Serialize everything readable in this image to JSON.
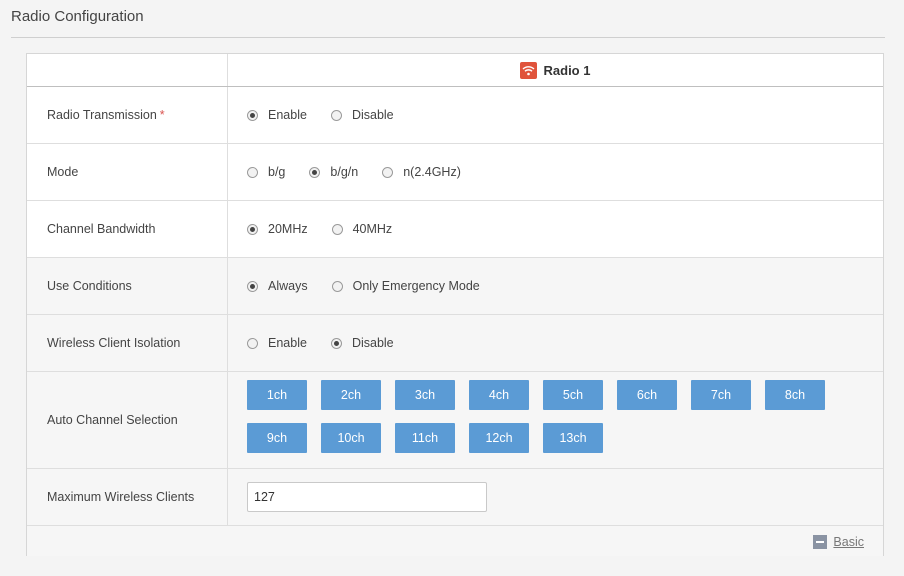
{
  "page": {
    "title": "Radio Configuration"
  },
  "header": {
    "radio_label": "Radio 1",
    "radio_icon": "wifi-icon",
    "accent": "#e0533b"
  },
  "rows": {
    "radio_transmission": {
      "label": "Radio Transmission",
      "required_mark": "*",
      "options": [
        {
          "label": "Enable",
          "selected": true
        },
        {
          "label": "Disable",
          "selected": false
        }
      ]
    },
    "mode": {
      "label": "Mode",
      "options": [
        {
          "label": "b/g",
          "selected": false
        },
        {
          "label": "b/g/n",
          "selected": true
        },
        {
          "label": "n(2.4GHz)",
          "selected": false
        }
      ]
    },
    "channel_bandwidth": {
      "label": "Channel Bandwidth",
      "options": [
        {
          "label": "20MHz",
          "selected": true
        },
        {
          "label": "40MHz",
          "selected": false
        }
      ]
    },
    "use_conditions": {
      "label": "Use Conditions",
      "options": [
        {
          "label": "Always",
          "selected": true
        },
        {
          "label": "Only Emergency Mode",
          "selected": false
        }
      ]
    },
    "client_isolation": {
      "label": "Wireless Client Isolation",
      "options": [
        {
          "label": "Enable",
          "selected": false
        },
        {
          "label": "Disable",
          "selected": true
        }
      ]
    },
    "auto_channel": {
      "label": "Auto Channel Selection",
      "channels": [
        "1ch",
        "2ch",
        "3ch",
        "4ch",
        "5ch",
        "6ch",
        "7ch",
        "8ch",
        "9ch",
        "10ch",
        "11ch",
        "12ch",
        "13ch"
      ],
      "button_color": "#5b9bd5"
    },
    "max_clients": {
      "label": "Maximum Wireless Clients",
      "value": "127"
    }
  },
  "footer": {
    "basic_label": "Basic"
  }
}
